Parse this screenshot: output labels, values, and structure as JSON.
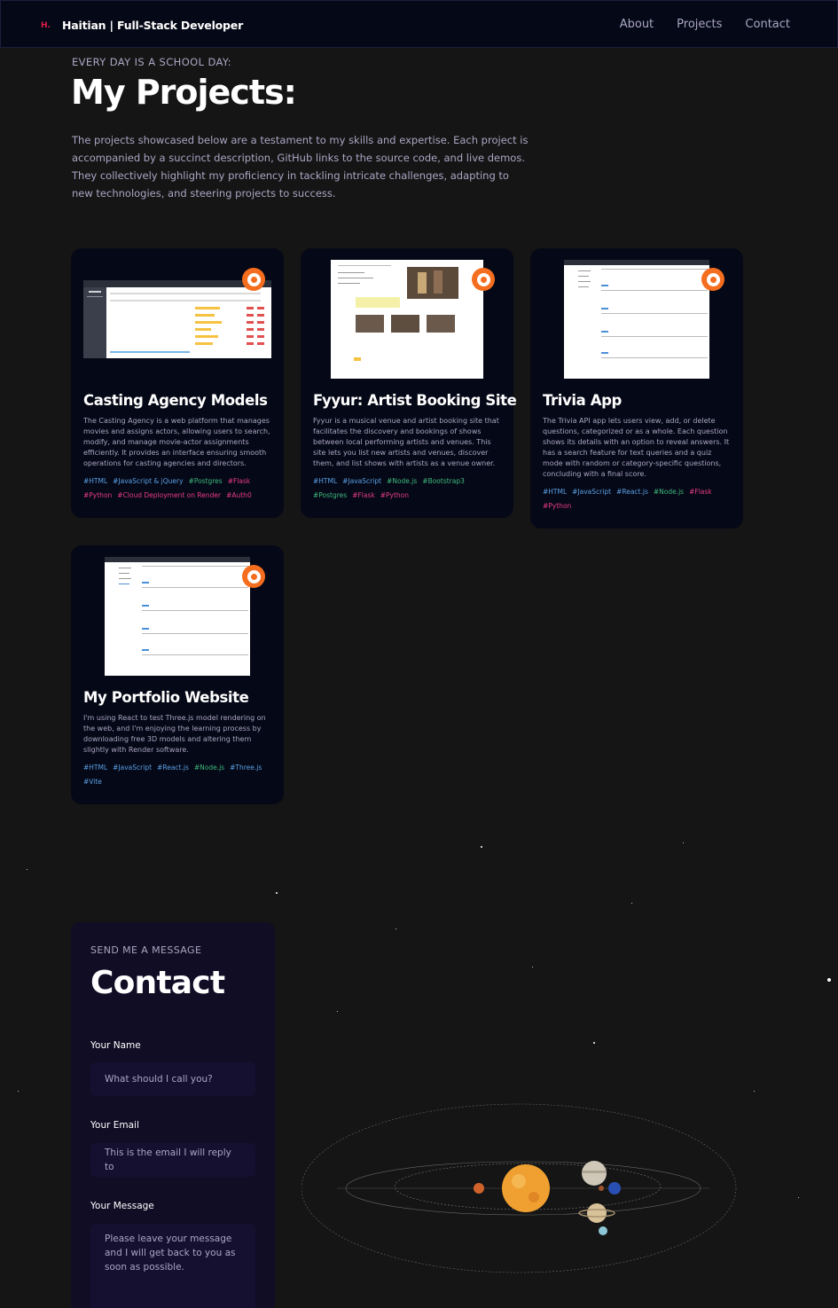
{
  "nav": {
    "logo_mark": "H.",
    "brand": "Haitian | Full-Stack Developer",
    "links": [
      "About",
      "Projects",
      "Contact"
    ]
  },
  "hero": {
    "eyebrow": "EVERY DAY IS A SCHOOL DAY:",
    "title": "My Projects:",
    "intro": "The projects showcased below are a testament to my skills and expertise. Each project is accompanied by a succinct description, GitHub links to the source code, and live demos. They collectively highlight my proficiency in tackling intricate challenges, adapting to new technologies, and steering projects to success."
  },
  "projects": [
    {
      "title": "Casting Agency Models",
      "description": "The Casting Agency is a web platform that manages movies and assigns actors, allowing users to search, modify, and manage movie-actor assignments efficiently. It provides an interface ensuring smooth operations for casting agencies and directors.",
      "tags": [
        {
          "name": "#HTML",
          "color": "blue"
        },
        {
          "name": "#JavaScript & jQuery",
          "color": "blue"
        },
        {
          "name": "#Postgres",
          "color": "green"
        },
        {
          "name": "#Flask",
          "color": "pink"
        },
        {
          "name": "#Python",
          "color": "pink"
        },
        {
          "name": "#Cloud Deployment on Render",
          "color": "pink"
        },
        {
          "name": "#Auth0",
          "color": "pink"
        }
      ],
      "icon": "github-icon"
    },
    {
      "title": "Fyyur: Artist Booking Site",
      "description": "Fyyur is a musical venue and artist booking site that facilitates the discovery and bookings of shows between local performing artists and venues. This site lets you list new artists and venues, discover them, and list shows with artists as a venue owner.",
      "tags": [
        {
          "name": "#HTML",
          "color": "blue"
        },
        {
          "name": "#JavaScript",
          "color": "blue"
        },
        {
          "name": "#Node.js",
          "color": "green"
        },
        {
          "name": "#Bootstrap3",
          "color": "green"
        },
        {
          "name": "#Postgres",
          "color": "green"
        },
        {
          "name": "#Flask",
          "color": "pink"
        },
        {
          "name": "#Python",
          "color": "pink"
        }
      ],
      "icon": "github-icon"
    },
    {
      "title": "Trivia App",
      "description": "The Trivia API app lets users view, add, or delete questions, categorized or as a whole. Each question shows its details with an option to reveal answers. It has a search feature for text queries and a quiz mode with random or category-specific questions, concluding with a final score.",
      "tags": [
        {
          "name": "#HTML",
          "color": "blue"
        },
        {
          "name": "#JavaScript",
          "color": "blue"
        },
        {
          "name": "#React.js",
          "color": "blue"
        },
        {
          "name": "#Node.js",
          "color": "green"
        },
        {
          "name": "#Flask",
          "color": "pink"
        },
        {
          "name": "#Python",
          "color": "pink"
        }
      ],
      "icon": "github-icon"
    },
    {
      "title": "My Portfolio Website",
      "description": "I'm using React to test Three.js model rendering on the web, and I'm enjoying the learning process by downloading free 3D models and altering them slightly with Render software.",
      "tags": [
        {
          "name": "#HTML",
          "color": "blue"
        },
        {
          "name": "#JavaScript",
          "color": "blue"
        },
        {
          "name": "#React.js",
          "color": "blue"
        },
        {
          "name": "#Node.js",
          "color": "green"
        },
        {
          "name": "#Three.js",
          "color": "blue"
        },
        {
          "name": "#Vite",
          "color": "blue"
        }
      ],
      "icon": "github-icon"
    }
  ],
  "contact": {
    "eyebrow": "SEND ME A MESSAGE",
    "title": "Contact",
    "name_label": "Your Name",
    "name_placeholder": "What should I call you?",
    "email_label": "Your Email",
    "email_placeholder": "This is the email I will reply to",
    "message_label": "Your Message",
    "message_placeholder": "Please leave your message and I will get back to you as soon as possible."
  },
  "colors": {
    "background": "#151515",
    "card": "#050816",
    "secondary_text": "#aaa6c3",
    "accent_orange": "#f56d1e",
    "tag_blue": "#5aa0e6",
    "tag_green": "#3fb97e",
    "tag_pink": "#e83d84"
  }
}
